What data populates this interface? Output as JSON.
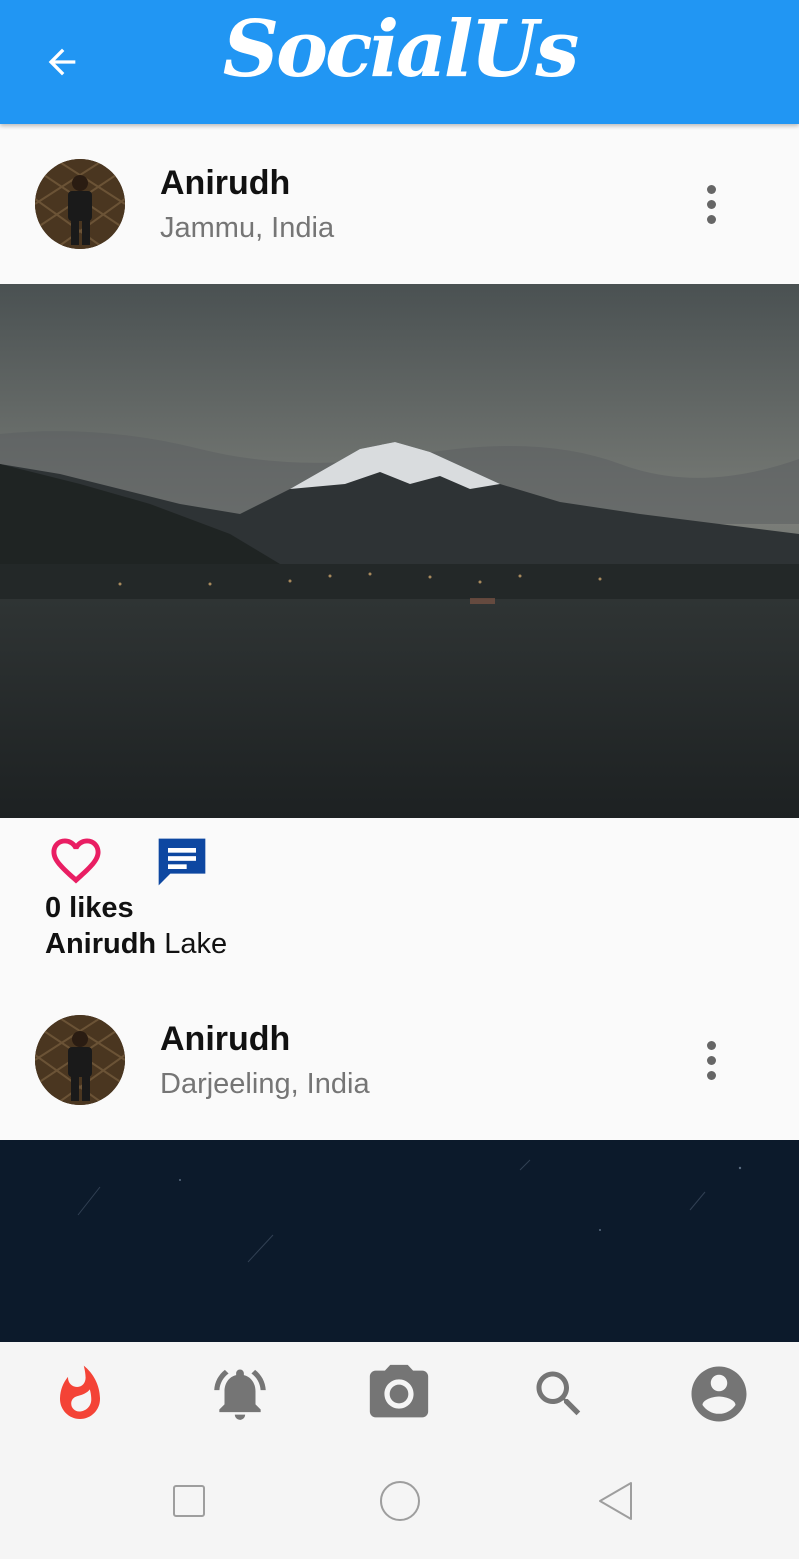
{
  "appbar": {
    "title": "SocialUs",
    "back_icon": "arrow-back-icon",
    "color": "#2196f3"
  },
  "posts": [
    {
      "user": "Anirudh",
      "location": "Jammu, India",
      "image": "mountain-lake-photo",
      "likes_label": "0 likes",
      "caption_user": "Anirudh",
      "caption_text": "Lake"
    },
    {
      "user": "Anirudh",
      "location": "Darjeeling, India",
      "image": "night-sky-photo"
    }
  ],
  "icons": {
    "like": "heart-outline-icon",
    "comment": "comment-icon",
    "more": "more-vert-icon"
  },
  "bottom_nav": [
    {
      "icon": "whatshot-icon",
      "active": true
    },
    {
      "icon": "notifications-icon",
      "active": false
    },
    {
      "icon": "camera-icon",
      "active": false
    },
    {
      "icon": "search-icon",
      "active": false
    },
    {
      "icon": "account-circle-icon",
      "active": false
    }
  ],
  "colors": {
    "accent": "#2196f3",
    "like": "#e91e63",
    "comment": "#0d47a1",
    "active_nav": "#f44336",
    "inactive_nav": "#757575"
  }
}
